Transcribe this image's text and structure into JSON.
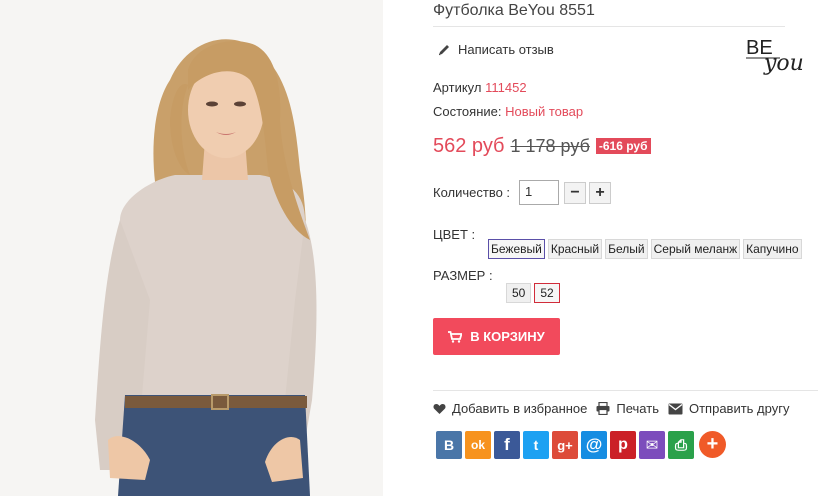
{
  "product": {
    "title": "Футболка BeYou 8551",
    "brand_logo": {
      "line1": "BE",
      "line2": "you"
    },
    "review_link": "Написать отзыв",
    "sku_label": "Артикул",
    "sku_value": "111452",
    "condition_label": "Состояние:",
    "condition_value": "Новый товар",
    "price_new": "562 руб",
    "price_old": "1 178 руб",
    "discount": "-616 руб",
    "quantity_label": "Количество :",
    "quantity_value": "1",
    "minus_label": "−",
    "plus_label": "+",
    "color_label": "ЦВЕТ :",
    "colors": [
      "Бежевый",
      "Красный",
      "Белый",
      "Серый меланж",
      "Капучино"
    ],
    "size_label": "РАЗМЕР :",
    "sizes": [
      "50",
      "52"
    ],
    "cart_button": "В КОРЗИНУ"
  },
  "actions": {
    "wishlist": "Добавить в избранное",
    "print": "Печать",
    "send": "Отправить другу"
  },
  "social": {
    "vk": "B",
    "ok": "ok",
    "fb": "f",
    "tw": "t",
    "gplus": "g+",
    "mail": "@",
    "pin": "p",
    "email": "✉",
    "print": "⎙",
    "more": "+"
  },
  "colors": {
    "accent": "#e34a5a",
    "cart": "#f24a5c",
    "vk": "#4a76a8",
    "ok": "#f7931e",
    "fb": "#3b5998",
    "tw": "#1da1f2",
    "gplus": "#dd4b39",
    "mail": "#168de2",
    "pin": "#cb2027",
    "email": "#7c4dbc",
    "print": "#2aa14a",
    "more": "#f05a28"
  }
}
